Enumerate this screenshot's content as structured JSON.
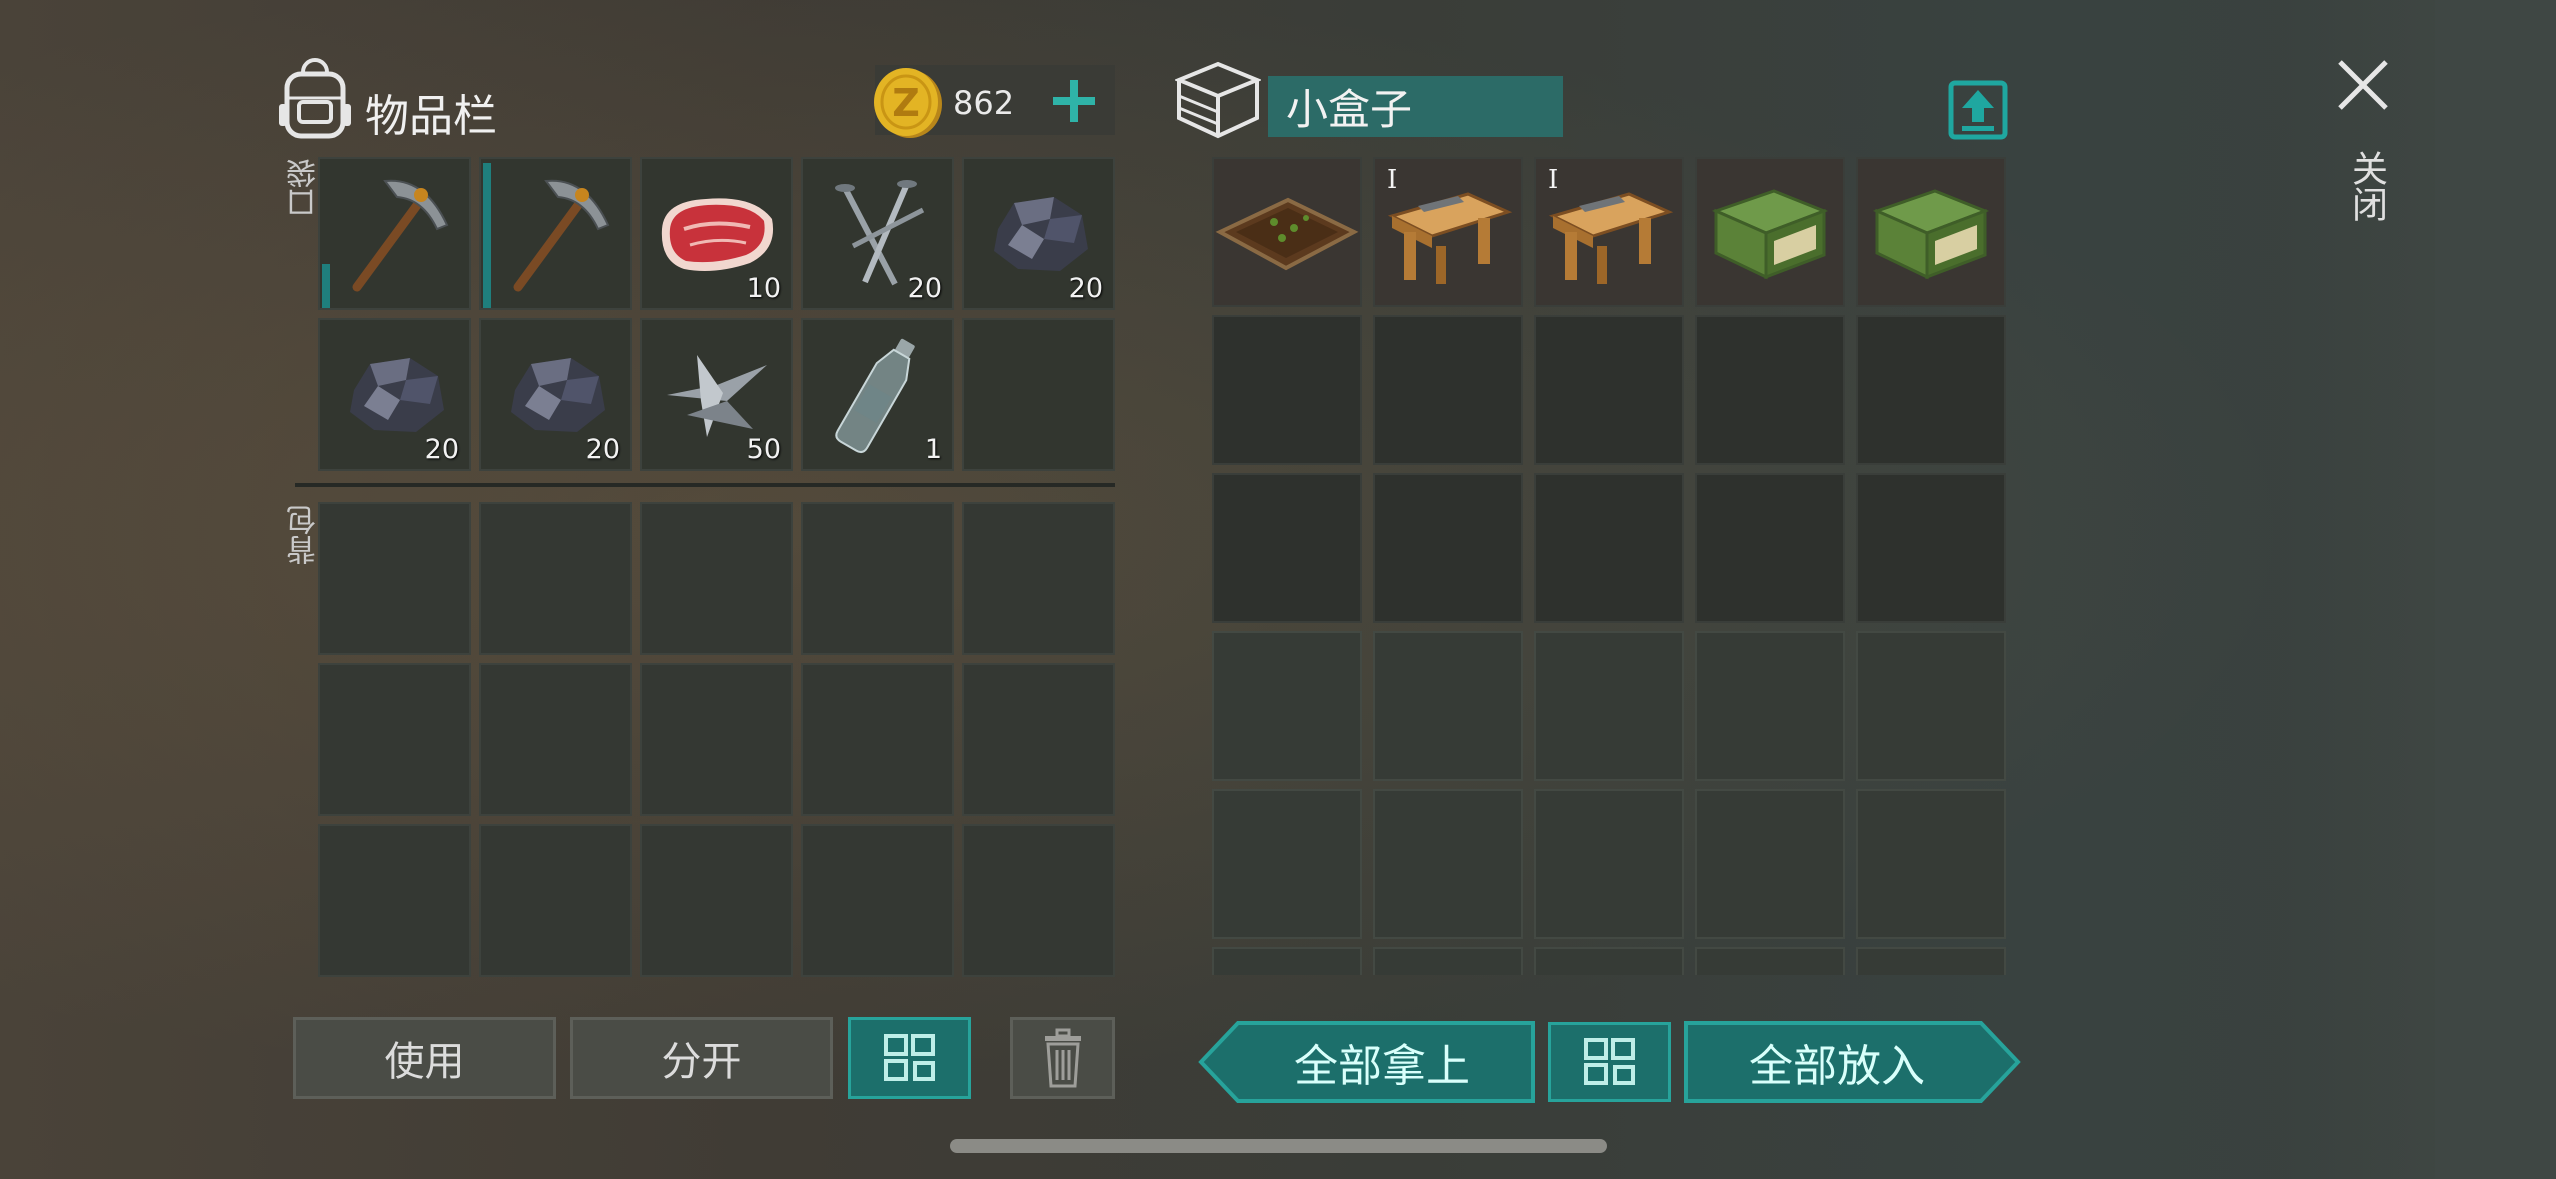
{
  "inventory": {
    "title": "物品栏",
    "coins": "862",
    "pocket_label": "口袋",
    "backpack_label": "背包",
    "pocket_slots": [
      {
        "item": "pickaxe-icon",
        "count": "",
        "durability": 0.25
      },
      {
        "item": "pickaxe-icon",
        "count": "",
        "durability": 0.9
      },
      {
        "item": "raw-meat-icon",
        "count": "10"
      },
      {
        "item": "nails-icon",
        "count": "20"
      },
      {
        "item": "iron-ore-icon",
        "count": "20"
      },
      {
        "item": "iron-ore-icon",
        "count": "20"
      },
      {
        "item": "iron-ore-icon",
        "count": "20"
      },
      {
        "item": "scrap-metal-icon",
        "count": "50"
      },
      {
        "item": "water-bottle-icon",
        "count": "1"
      },
      {
        "item": "",
        "count": ""
      }
    ],
    "backpack_rows": 3,
    "buttons": {
      "use": "使用",
      "split": "分开"
    }
  },
  "container": {
    "title": "小盒子",
    "slots": [
      {
        "item": "garden-bed-icon",
        "tier": ""
      },
      {
        "item": "workbench-icon",
        "tier": "I"
      },
      {
        "item": "workbench-icon",
        "tier": "I"
      },
      {
        "item": "green-crate-icon",
        "tier": ""
      },
      {
        "item": "green-crate-icon",
        "tier": ""
      }
    ],
    "buttons": {
      "take_all": "全部拿上",
      "put_all": "全部放入"
    }
  },
  "close_label": "关闭",
  "colors": {
    "accent": "#1c6f6b",
    "accent_border": "#27a39b",
    "coin": "#e3b424"
  }
}
